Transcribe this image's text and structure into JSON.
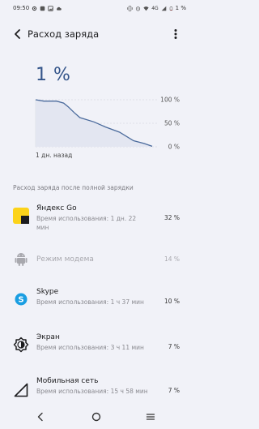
{
  "status_bar": {
    "time": "09:50",
    "network": "4G",
    "battery": "1 %"
  },
  "app_bar": {
    "title": "Расход заряда"
  },
  "summary": {
    "level": "1 %",
    "x_label": "1 дн. назад"
  },
  "chart_data": {
    "type": "area",
    "y_ticks": [
      "100 %",
      "50 %",
      "0 %"
    ],
    "ylim": [
      0,
      100
    ],
    "x_label": "1 дн. назад",
    "points": [
      [
        0,
        100
      ],
      [
        0.07,
        97
      ],
      [
        0.18,
        97
      ],
      [
        0.24,
        93
      ],
      [
        0.28,
        85
      ],
      [
        0.33,
        73
      ],
      [
        0.38,
        62
      ],
      [
        0.5,
        53
      ],
      [
        0.6,
        42
      ],
      [
        0.72,
        31
      ],
      [
        0.84,
        13
      ],
      [
        0.93,
        7
      ],
      [
        1.0,
        1
      ]
    ],
    "colors": {
      "line": "#4a6a9c",
      "fill": "#e3e6f1",
      "grid": "#d8dae2"
    }
  },
  "section": {
    "header": "Расход заряда после полной зарядки"
  },
  "apps": [
    {
      "name": "Яндекс Go",
      "sub": "Время использования: 1 дн. 22 мин",
      "percent": "32 %",
      "icon": "yandex-go-icon"
    },
    {
      "name": "Режим модема",
      "sub": "",
      "percent": "14 %",
      "icon": "android-icon"
    },
    {
      "name": "Skype",
      "sub": "Время использования: 1 ч 37 мин",
      "percent": "10 %",
      "icon": "skype-icon"
    },
    {
      "name": "Экран",
      "sub": "Время использования: 3 ч 11 мин",
      "percent": "7 %",
      "icon": "brightness-icon"
    },
    {
      "name": "Мобильная сеть",
      "sub": "Время использования: 15 ч 58 мин",
      "percent": "7 %",
      "icon": "signal-icon"
    }
  ]
}
